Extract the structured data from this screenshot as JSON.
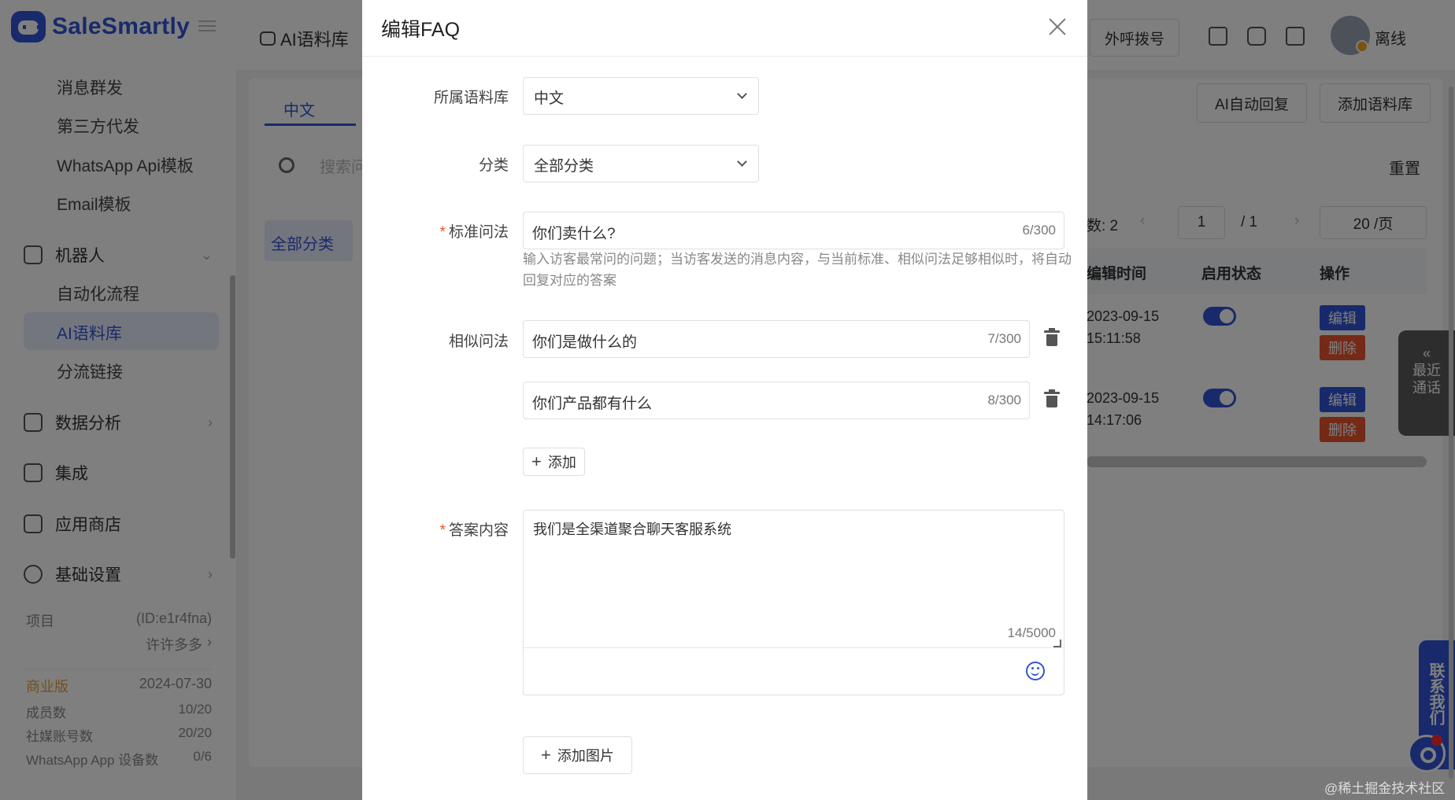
{
  "app": {
    "logo_text": "SaleSmartly"
  },
  "sidebar": {
    "sub_items": [
      "消息群发",
      "第三方代发",
      "WhatsApp Api模板",
      "Email模板"
    ],
    "robot": {
      "label": "机器人"
    },
    "robot_items": [
      "自动化流程",
      "AI语料库",
      "分流链接"
    ],
    "active_item": "AI语料库",
    "main_items": [
      "数据分析",
      "集成",
      "应用商店",
      "基础设置"
    ],
    "project": {
      "label": "项目",
      "id": "(ID:e1r4fna)",
      "name": "许许多多",
      "plan": "商业版",
      "expire": "2024-07-30",
      "rows": [
        {
          "label": "成员数",
          "value": "10/20"
        },
        {
          "label": "社媒账号数",
          "value": "20/20"
        },
        {
          "label": "WhatsApp App 设备数",
          "value": "0/6"
        }
      ]
    }
  },
  "topbar": {
    "breadcrumb": "AI语料库",
    "outbound_label": "外呼拨号",
    "status": "离线"
  },
  "page": {
    "tab": "中文",
    "search_placeholder": "搜索问",
    "category": "全部分类",
    "btn_ai_reply": "AI自动回复",
    "btn_add_corpus": "添加语料库",
    "reset": "重置",
    "total_label": "数: 2",
    "page_current": "1",
    "page_total": "/ 1",
    "page_size": "20 /页",
    "columns": {
      "edit_time": "编辑时间",
      "enabled": "启用状态",
      "actions": "操作"
    },
    "rows": [
      {
        "date": "2023-09-15",
        "time": "15:11:58",
        "enabled": true
      },
      {
        "date": "2023-09-15",
        "time": "14:17:06",
        "enabled": true
      }
    ],
    "edit_label": "编辑",
    "delete_label": "删除",
    "recent_call": [
      "最近",
      "通话"
    ],
    "contact_us": "联系我们",
    "watermark": "@稀土掘金技术社区"
  },
  "modal": {
    "title": "编辑FAQ",
    "corpus_label": "所属语料库",
    "corpus_value": "中文",
    "category_label": "分类",
    "category_value": "全部分类",
    "question_label": "标准问法",
    "question_value": "你们卖什么?",
    "question_count": "6/300",
    "question_hint": "输入访客最常问的问题；当访客发送的消息内容，与当前标准、相似问法足够相似时，将自动回复对应的答案",
    "similar_label": "相似问法",
    "similar": [
      {
        "value": "你们是做什么的",
        "count": "7/300"
      },
      {
        "value": "你们产品都有什么",
        "count": "8/300"
      }
    ],
    "add_label": "添加",
    "answer_label": "答案内容",
    "answer_value": "我们是全渠道聚合聊天客服系统",
    "answer_count": "14/5000",
    "add_image_label": "添加图片"
  }
}
